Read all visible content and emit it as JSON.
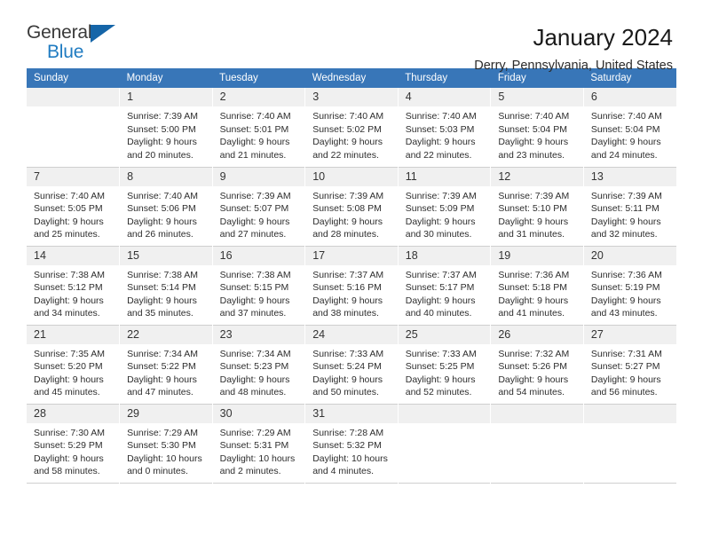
{
  "brand": {
    "word_one": "General",
    "word_two": "Blue",
    "triangle_color": "#1565a8",
    "blue": "#1f7bc1"
  },
  "header": {
    "title": "January 2024",
    "subtitle": "Derry, Pennsylvania, United States",
    "header_bg": "#3876b8",
    "daynum_bg": "#f0f0f0"
  },
  "weekdays": [
    "Sunday",
    "Monday",
    "Tuesday",
    "Wednesday",
    "Thursday",
    "Friday",
    "Saturday"
  ],
  "labels": {
    "sunrise": "Sunrise:",
    "sunset": "Sunset:",
    "daylight": "Daylight:"
  },
  "weeks": [
    [
      {
        "day": "",
        "blank": true
      },
      {
        "day": "1",
        "sunrise": "Sunrise: 7:39 AM",
        "sunset": "Sunset: 5:00 PM",
        "daylight1": "Daylight: 9 hours",
        "daylight2": "and 20 minutes."
      },
      {
        "day": "2",
        "sunrise": "Sunrise: 7:40 AM",
        "sunset": "Sunset: 5:01 PM",
        "daylight1": "Daylight: 9 hours",
        "daylight2": "and 21 minutes."
      },
      {
        "day": "3",
        "sunrise": "Sunrise: 7:40 AM",
        "sunset": "Sunset: 5:02 PM",
        "daylight1": "Daylight: 9 hours",
        "daylight2": "and 22 minutes."
      },
      {
        "day": "4",
        "sunrise": "Sunrise: 7:40 AM",
        "sunset": "Sunset: 5:03 PM",
        "daylight1": "Daylight: 9 hours",
        "daylight2": "and 22 minutes."
      },
      {
        "day": "5",
        "sunrise": "Sunrise: 7:40 AM",
        "sunset": "Sunset: 5:04 PM",
        "daylight1": "Daylight: 9 hours",
        "daylight2": "and 23 minutes."
      },
      {
        "day": "6",
        "sunrise": "Sunrise: 7:40 AM",
        "sunset": "Sunset: 5:04 PM",
        "daylight1": "Daylight: 9 hours",
        "daylight2": "and 24 minutes."
      }
    ],
    [
      {
        "day": "7",
        "sunrise": "Sunrise: 7:40 AM",
        "sunset": "Sunset: 5:05 PM",
        "daylight1": "Daylight: 9 hours",
        "daylight2": "and 25 minutes."
      },
      {
        "day": "8",
        "sunrise": "Sunrise: 7:40 AM",
        "sunset": "Sunset: 5:06 PM",
        "daylight1": "Daylight: 9 hours",
        "daylight2": "and 26 minutes."
      },
      {
        "day": "9",
        "sunrise": "Sunrise: 7:39 AM",
        "sunset": "Sunset: 5:07 PM",
        "daylight1": "Daylight: 9 hours",
        "daylight2": "and 27 minutes."
      },
      {
        "day": "10",
        "sunrise": "Sunrise: 7:39 AM",
        "sunset": "Sunset: 5:08 PM",
        "daylight1": "Daylight: 9 hours",
        "daylight2": "and 28 minutes."
      },
      {
        "day": "11",
        "sunrise": "Sunrise: 7:39 AM",
        "sunset": "Sunset: 5:09 PM",
        "daylight1": "Daylight: 9 hours",
        "daylight2": "and 30 minutes."
      },
      {
        "day": "12",
        "sunrise": "Sunrise: 7:39 AM",
        "sunset": "Sunset: 5:10 PM",
        "daylight1": "Daylight: 9 hours",
        "daylight2": "and 31 minutes."
      },
      {
        "day": "13",
        "sunrise": "Sunrise: 7:39 AM",
        "sunset": "Sunset: 5:11 PM",
        "daylight1": "Daylight: 9 hours",
        "daylight2": "and 32 minutes."
      }
    ],
    [
      {
        "day": "14",
        "sunrise": "Sunrise: 7:38 AM",
        "sunset": "Sunset: 5:12 PM",
        "daylight1": "Daylight: 9 hours",
        "daylight2": "and 34 minutes."
      },
      {
        "day": "15",
        "sunrise": "Sunrise: 7:38 AM",
        "sunset": "Sunset: 5:14 PM",
        "daylight1": "Daylight: 9 hours",
        "daylight2": "and 35 minutes."
      },
      {
        "day": "16",
        "sunrise": "Sunrise: 7:38 AM",
        "sunset": "Sunset: 5:15 PM",
        "daylight1": "Daylight: 9 hours",
        "daylight2": "and 37 minutes."
      },
      {
        "day": "17",
        "sunrise": "Sunrise: 7:37 AM",
        "sunset": "Sunset: 5:16 PM",
        "daylight1": "Daylight: 9 hours",
        "daylight2": "and 38 minutes."
      },
      {
        "day": "18",
        "sunrise": "Sunrise: 7:37 AM",
        "sunset": "Sunset: 5:17 PM",
        "daylight1": "Daylight: 9 hours",
        "daylight2": "and 40 minutes."
      },
      {
        "day": "19",
        "sunrise": "Sunrise: 7:36 AM",
        "sunset": "Sunset: 5:18 PM",
        "daylight1": "Daylight: 9 hours",
        "daylight2": "and 41 minutes."
      },
      {
        "day": "20",
        "sunrise": "Sunrise: 7:36 AM",
        "sunset": "Sunset: 5:19 PM",
        "daylight1": "Daylight: 9 hours",
        "daylight2": "and 43 minutes."
      }
    ],
    [
      {
        "day": "21",
        "sunrise": "Sunrise: 7:35 AM",
        "sunset": "Sunset: 5:20 PM",
        "daylight1": "Daylight: 9 hours",
        "daylight2": "and 45 minutes."
      },
      {
        "day": "22",
        "sunrise": "Sunrise: 7:34 AM",
        "sunset": "Sunset: 5:22 PM",
        "daylight1": "Daylight: 9 hours",
        "daylight2": "and 47 minutes."
      },
      {
        "day": "23",
        "sunrise": "Sunrise: 7:34 AM",
        "sunset": "Sunset: 5:23 PM",
        "daylight1": "Daylight: 9 hours",
        "daylight2": "and 48 minutes."
      },
      {
        "day": "24",
        "sunrise": "Sunrise: 7:33 AM",
        "sunset": "Sunset: 5:24 PM",
        "daylight1": "Daylight: 9 hours",
        "daylight2": "and 50 minutes."
      },
      {
        "day": "25",
        "sunrise": "Sunrise: 7:33 AM",
        "sunset": "Sunset: 5:25 PM",
        "daylight1": "Daylight: 9 hours",
        "daylight2": "and 52 minutes."
      },
      {
        "day": "26",
        "sunrise": "Sunrise: 7:32 AM",
        "sunset": "Sunset: 5:26 PM",
        "daylight1": "Daylight: 9 hours",
        "daylight2": "and 54 minutes."
      },
      {
        "day": "27",
        "sunrise": "Sunrise: 7:31 AM",
        "sunset": "Sunset: 5:27 PM",
        "daylight1": "Daylight: 9 hours",
        "daylight2": "and 56 minutes."
      }
    ],
    [
      {
        "day": "28",
        "sunrise": "Sunrise: 7:30 AM",
        "sunset": "Sunset: 5:29 PM",
        "daylight1": "Daylight: 9 hours",
        "daylight2": "and 58 minutes."
      },
      {
        "day": "29",
        "sunrise": "Sunrise: 7:29 AM",
        "sunset": "Sunset: 5:30 PM",
        "daylight1": "Daylight: 10 hours",
        "daylight2": "and 0 minutes."
      },
      {
        "day": "30",
        "sunrise": "Sunrise: 7:29 AM",
        "sunset": "Sunset: 5:31 PM",
        "daylight1": "Daylight: 10 hours",
        "daylight2": "and 2 minutes."
      },
      {
        "day": "31",
        "sunrise": "Sunrise: 7:28 AM",
        "sunset": "Sunset: 5:32 PM",
        "daylight1": "Daylight: 10 hours",
        "daylight2": "and 4 minutes."
      },
      {
        "day": "",
        "blank": true
      },
      {
        "day": "",
        "blank": true
      },
      {
        "day": "",
        "blank": true
      }
    ]
  ]
}
